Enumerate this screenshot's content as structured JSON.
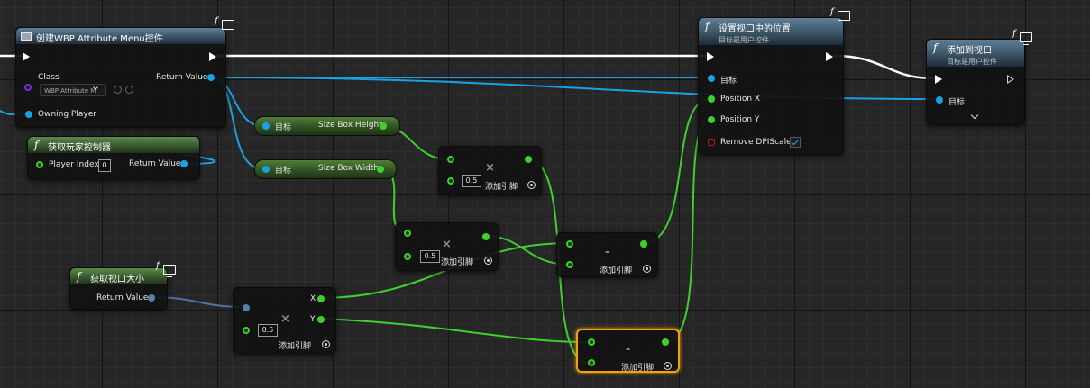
{
  "colors": {
    "exec_wire": "#ffffff",
    "object_wire": "#1ba1e2",
    "float_wire": "#3fcf2f",
    "vector2d_wire": "#5a7fae",
    "selection": "#f0a010"
  },
  "nodes": {
    "create_widget": {
      "title": "创建WBP Attribute Menu控件",
      "class_label": "Class",
      "class_value": "WBP Attribute M",
      "return_label": "Return Value",
      "owning_player_label": "Owning Player"
    },
    "get_player_controller": {
      "title": "获取玩家控制器",
      "player_index_label": "Player Index",
      "player_index_value": "0",
      "return_label": "Return Value"
    },
    "get_size_box_height": {
      "target_label": "目标",
      "output_label": "Size Box Height"
    },
    "get_size_box_width": {
      "target_label": "目标",
      "output_label": "Size Box Width"
    },
    "multiply_height": {
      "operator": "×",
      "value": "0.5",
      "add_pin_label": "添加引脚"
    },
    "multiply_width": {
      "operator": "×",
      "value": "0.5",
      "add_pin_label": "添加引脚"
    },
    "multiply_viewport": {
      "operator": "×",
      "value": "0.5",
      "add_pin_label": "添加引脚",
      "x_label": "X",
      "y_label": "Y"
    },
    "subtract_x": {
      "operator": "-",
      "add_pin_label": "添加引脚"
    },
    "subtract_y": {
      "operator": "-",
      "add_pin_label": "添加引脚"
    },
    "get_viewport_size": {
      "title": "获取视口大小",
      "return_label": "Return Value"
    },
    "set_position_in_viewport": {
      "title": "设置视口中的位置",
      "subtitle": "目标是用户控件",
      "target_label": "目标",
      "position_x_label": "Position X",
      "position_y_label": "Position Y",
      "remove_dpi_label": "Remove DPIScale",
      "remove_dpi_checked": true
    },
    "add_to_viewport": {
      "title": "添加到视口",
      "subtitle": "目标是用户控件",
      "target_label": "目标"
    }
  }
}
